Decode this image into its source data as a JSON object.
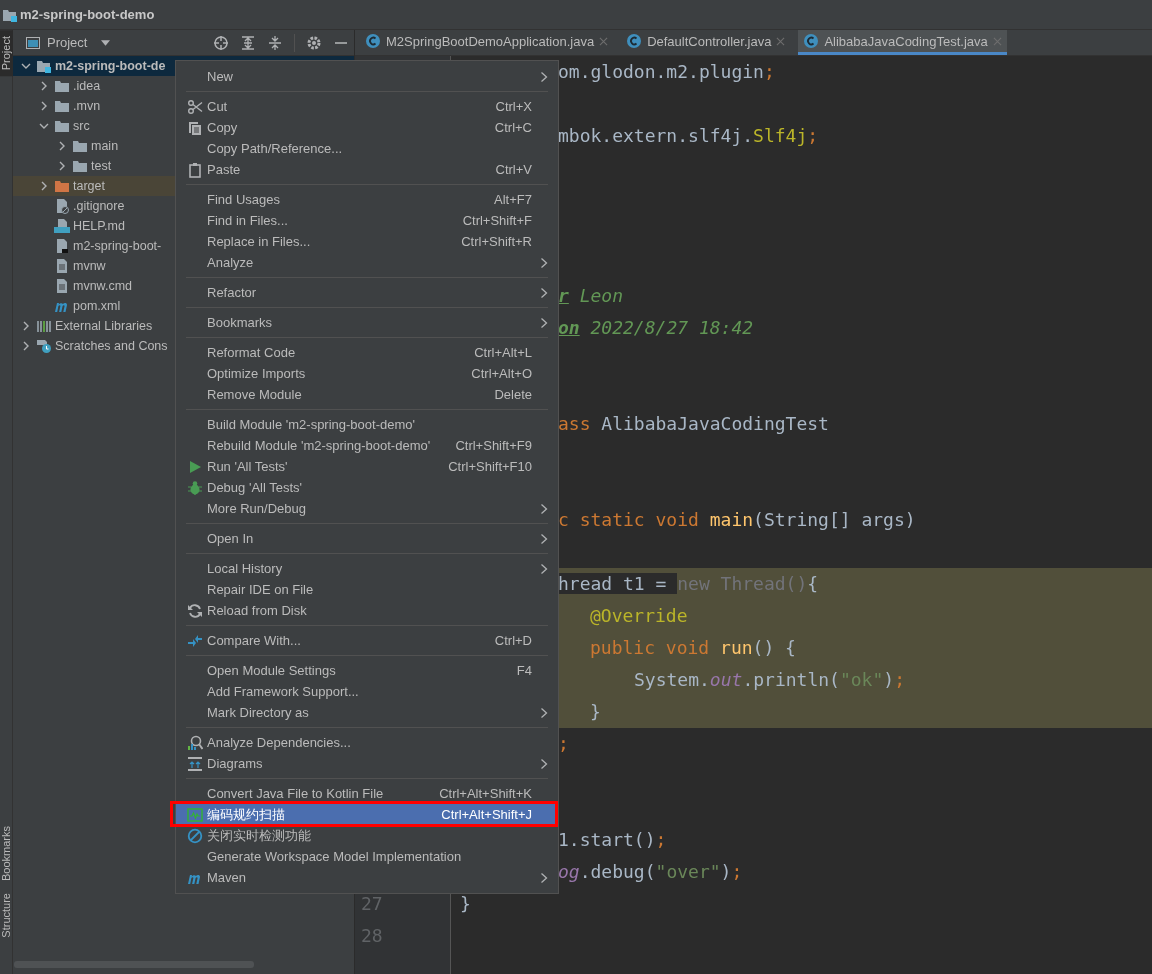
{
  "window": {
    "title": "m2-spring-boot-demo"
  },
  "tool_strip": [
    {
      "label": "Project",
      "selected": true
    },
    {
      "label": "Bookmarks",
      "selected": false
    },
    {
      "label": "Structure",
      "selected": false
    }
  ],
  "project_panel": {
    "title": "Project",
    "tree": [
      {
        "label": "m2-spring-boot-de",
        "kind": "module",
        "selected": true,
        "expanded": true,
        "children": [
          {
            "label": ".idea",
            "kind": "folder",
            "selected": false,
            "expanded": false
          },
          {
            "label": ".mvn",
            "kind": "folder",
            "selected": false,
            "expanded": false
          },
          {
            "label": "src",
            "kind": "folder",
            "selected": false,
            "expanded": true,
            "children": [
              {
                "label": "main",
                "kind": "folder",
                "selected": false,
                "expanded": false
              },
              {
                "label": "test",
                "kind": "folder",
                "selected": false,
                "expanded": false
              }
            ]
          },
          {
            "label": "target",
            "kind": "excluded-folder",
            "selected": false,
            "expanded": false
          },
          {
            "label": ".gitignore",
            "kind": "ignore-file",
            "selected": false
          },
          {
            "label": "HELP.md",
            "kind": "markdown-file",
            "selected": false
          },
          {
            "label": "m2-spring-boot-",
            "kind": "module-file",
            "selected": false
          },
          {
            "label": "mvnw",
            "kind": "text-file",
            "selected": false
          },
          {
            "label": "mvnw.cmd",
            "kind": "text-file",
            "selected": false
          },
          {
            "label": "pom.xml",
            "kind": "maven-file",
            "selected": false
          }
        ]
      },
      {
        "label": "External Libraries",
        "kind": "libraries",
        "selected": false,
        "expanded": false
      },
      {
        "label": "Scratches and Cons",
        "kind": "scratches",
        "selected": false,
        "expanded": false
      }
    ]
  },
  "tabs": [
    {
      "label": "M2SpringBootDemoApplication.java",
      "selected": false
    },
    {
      "label": "DefaultController.java",
      "selected": false
    },
    {
      "label": "AlibabaJavaCodingTest.java",
      "selected": true
    }
  ],
  "editor": {
    "gutter": [
      "27",
      "28"
    ],
    "lines": [
      {
        "highlighted": false,
        "tokens": [
          {
            "text": "om.glodon.m2.plugin",
            "kind": "plain"
          },
          {
            "text": ";",
            "kind": "punct"
          }
        ]
      },
      {
        "highlighted": false
      },
      {
        "highlighted": false,
        "tokens": [
          {
            "text": "mbok.extern.slf4j.",
            "kind": "plain"
          },
          {
            "text": "Slf4j",
            "kind": "annotation"
          },
          {
            "text": ";",
            "kind": "punct"
          }
        ]
      },
      {
        "highlighted": false
      },
      {
        "highlighted": false
      },
      {
        "highlighted": false
      },
      {
        "highlighted": false
      },
      {
        "highlighted": false,
        "tokens": [
          {
            "text": "r",
            "kind": "doctag"
          },
          {
            "text": " Leon",
            "kind": "doc"
          }
        ]
      },
      {
        "highlighted": false,
        "tokens": [
          {
            "text": "on",
            "kind": "doctag"
          },
          {
            "text": " 2022/8/27 18:42",
            "kind": "doc"
          }
        ]
      },
      {
        "highlighted": false
      },
      {
        "highlighted": false
      },
      {
        "highlighted": false,
        "tokens": [
          {
            "text": "ass",
            "kind": "keyword"
          },
          {
            "text": " AlibabaJavaCodingTest",
            "kind": "plain"
          }
        ]
      },
      {
        "highlighted": false
      },
      {
        "highlighted": false
      },
      {
        "highlighted": false,
        "tokens": [
          {
            "text": "c static void",
            "kind": "keyword"
          },
          {
            "text": " main",
            "kind": "method"
          },
          {
            "text": "(String[] args)",
            "kind": "plain"
          }
        ]
      },
      {
        "highlighted": false
      },
      {
        "highlighted": true,
        "tokens": [
          {
            "text": "hread t1 = ",
            "kind": "plain",
            "highlighted": false
          },
          {
            "text": "new Thread()",
            "kind": "unused",
            "highlighted": true
          },
          {
            "text": "{",
            "kind": "plain",
            "highlighted": true
          }
        ]
      },
      {
        "highlighted": true,
        "tokens": [
          {
            "text": "@Override",
            "kind": "annotation"
          }
        ]
      },
      {
        "highlighted": true,
        "tokens": [
          {
            "text": "public void",
            "kind": "keyword"
          },
          {
            "text": " run",
            "kind": "method"
          },
          {
            "text": "() {",
            "kind": "plain"
          }
        ]
      },
      {
        "highlighted": true,
        "tokens": [
          {
            "text": "System.",
            "kind": "plain"
          },
          {
            "text": "out",
            "kind": "static"
          },
          {
            "text": ".println(",
            "kind": "plain"
          },
          {
            "text": "\"ok\"",
            "kind": "string"
          },
          {
            "text": ")",
            "kind": "plain"
          },
          {
            "text": ";",
            "kind": "punct"
          }
        ]
      },
      {
        "highlighted": true,
        "tokens": [
          {
            "text": "}",
            "kind": "plain"
          }
        ]
      },
      {
        "highlighted": false,
        "tokens": [
          {
            "text": ";",
            "kind": "punct"
          }
        ]
      },
      {
        "highlighted": false
      },
      {
        "highlighted": false
      },
      {
        "highlighted": false,
        "tokens": [
          {
            "text": "1.start()",
            "kind": "plain"
          },
          {
            "text": ";",
            "kind": "punct"
          }
        ]
      },
      {
        "highlighted": false,
        "tokens": [
          {
            "text": "og",
            "kind": "static"
          },
          {
            "text": ".debug(",
            "kind": "plain"
          },
          {
            "text": "\"over\"",
            "kind": "string"
          },
          {
            "text": ")",
            "kind": "plain"
          },
          {
            "text": ";",
            "kind": "punct"
          }
        ]
      },
      {
        "highlighted": false,
        "tokens": [
          {
            "text": "}",
            "kind": "plain"
          }
        ]
      },
      {
        "highlighted": false
      }
    ]
  },
  "context_menu": {
    "groups": [
      [
        {
          "label": "New",
          "submenu": true,
          "selected": false
        }
      ],
      [
        {
          "label": "Cut",
          "shortcut": "Ctrl+X",
          "submenu": false,
          "selected": false
        },
        {
          "label": "Copy",
          "shortcut": "Ctrl+C",
          "submenu": false,
          "selected": false
        },
        {
          "label": "Copy Path/Reference...",
          "submenu": false,
          "selected": false
        },
        {
          "label": "Paste",
          "shortcut": "Ctrl+V",
          "submenu": false,
          "selected": false
        }
      ],
      [
        {
          "label": "Find Usages",
          "shortcut": "Alt+F7",
          "submenu": false,
          "selected": false
        },
        {
          "label": "Find in Files...",
          "shortcut": "Ctrl+Shift+F",
          "submenu": false,
          "selected": false
        },
        {
          "label": "Replace in Files...",
          "shortcut": "Ctrl+Shift+R",
          "submenu": false,
          "selected": false
        },
        {
          "label": "Analyze",
          "submenu": true,
          "selected": false
        }
      ],
      [
        {
          "label": "Refactor",
          "submenu": true,
          "selected": false
        }
      ],
      [
        {
          "label": "Bookmarks",
          "submenu": true,
          "selected": false
        }
      ],
      [
        {
          "label": "Reformat Code",
          "shortcut": "Ctrl+Alt+L",
          "submenu": false,
          "selected": false
        },
        {
          "label": "Optimize Imports",
          "shortcut": "Ctrl+Alt+O",
          "submenu": false,
          "selected": false
        },
        {
          "label": "Remove Module",
          "shortcut": "Delete",
          "submenu": false,
          "selected": false
        }
      ],
      [
        {
          "label": "Build Module 'm2-spring-boot-demo'",
          "submenu": false,
          "selected": false
        },
        {
          "label": "Rebuild Module 'm2-spring-boot-demo'",
          "shortcut": "Ctrl+Shift+F9",
          "submenu": false,
          "selected": false
        },
        {
          "label": "Run 'All Tests'",
          "shortcut": "Ctrl+Shift+F10",
          "submenu": false,
          "selected": false
        },
        {
          "label": "Debug 'All Tests'",
          "submenu": false,
          "selected": false
        },
        {
          "label": "More Run/Debug",
          "submenu": true,
          "selected": false
        }
      ],
      [
        {
          "label": "Open In",
          "submenu": true,
          "selected": false
        }
      ],
      [
        {
          "label": "Local History",
          "submenu": true,
          "selected": false
        },
        {
          "label": "Repair IDE on File",
          "submenu": false,
          "selected": false
        },
        {
          "label": "Reload from Disk",
          "submenu": false,
          "selected": false
        }
      ],
      [
        {
          "label": "Compare With...",
          "shortcut": "Ctrl+D",
          "submenu": false,
          "selected": false
        }
      ],
      [
        {
          "label": "Open Module Settings",
          "shortcut": "F4",
          "submenu": false,
          "selected": false
        },
        {
          "label": "Add Framework Support...",
          "submenu": false,
          "selected": false
        },
        {
          "label": "Mark Directory as",
          "submenu": true,
          "selected": false
        }
      ],
      [
        {
          "label": "Analyze Dependencies...",
          "submenu": false,
          "selected": false
        },
        {
          "label": "Diagrams",
          "submenu": true,
          "selected": false
        }
      ],
      [
        {
          "label": "Convert Java File to Kotlin File",
          "shortcut": "Ctrl+Alt+Shift+K",
          "submenu": false,
          "selected": false
        },
        {
          "label": "编码规约扫描",
          "shortcut": "Ctrl+Alt+Shift+J",
          "submenu": false,
          "selected": true
        },
        {
          "label": "关闭实时检测功能",
          "submenu": false,
          "selected": false
        },
        {
          "label": "Generate Workspace Model Implementation",
          "submenu": false,
          "selected": false
        },
        {
          "label": "Maven",
          "submenu": true,
          "selected": false
        }
      ]
    ]
  }
}
